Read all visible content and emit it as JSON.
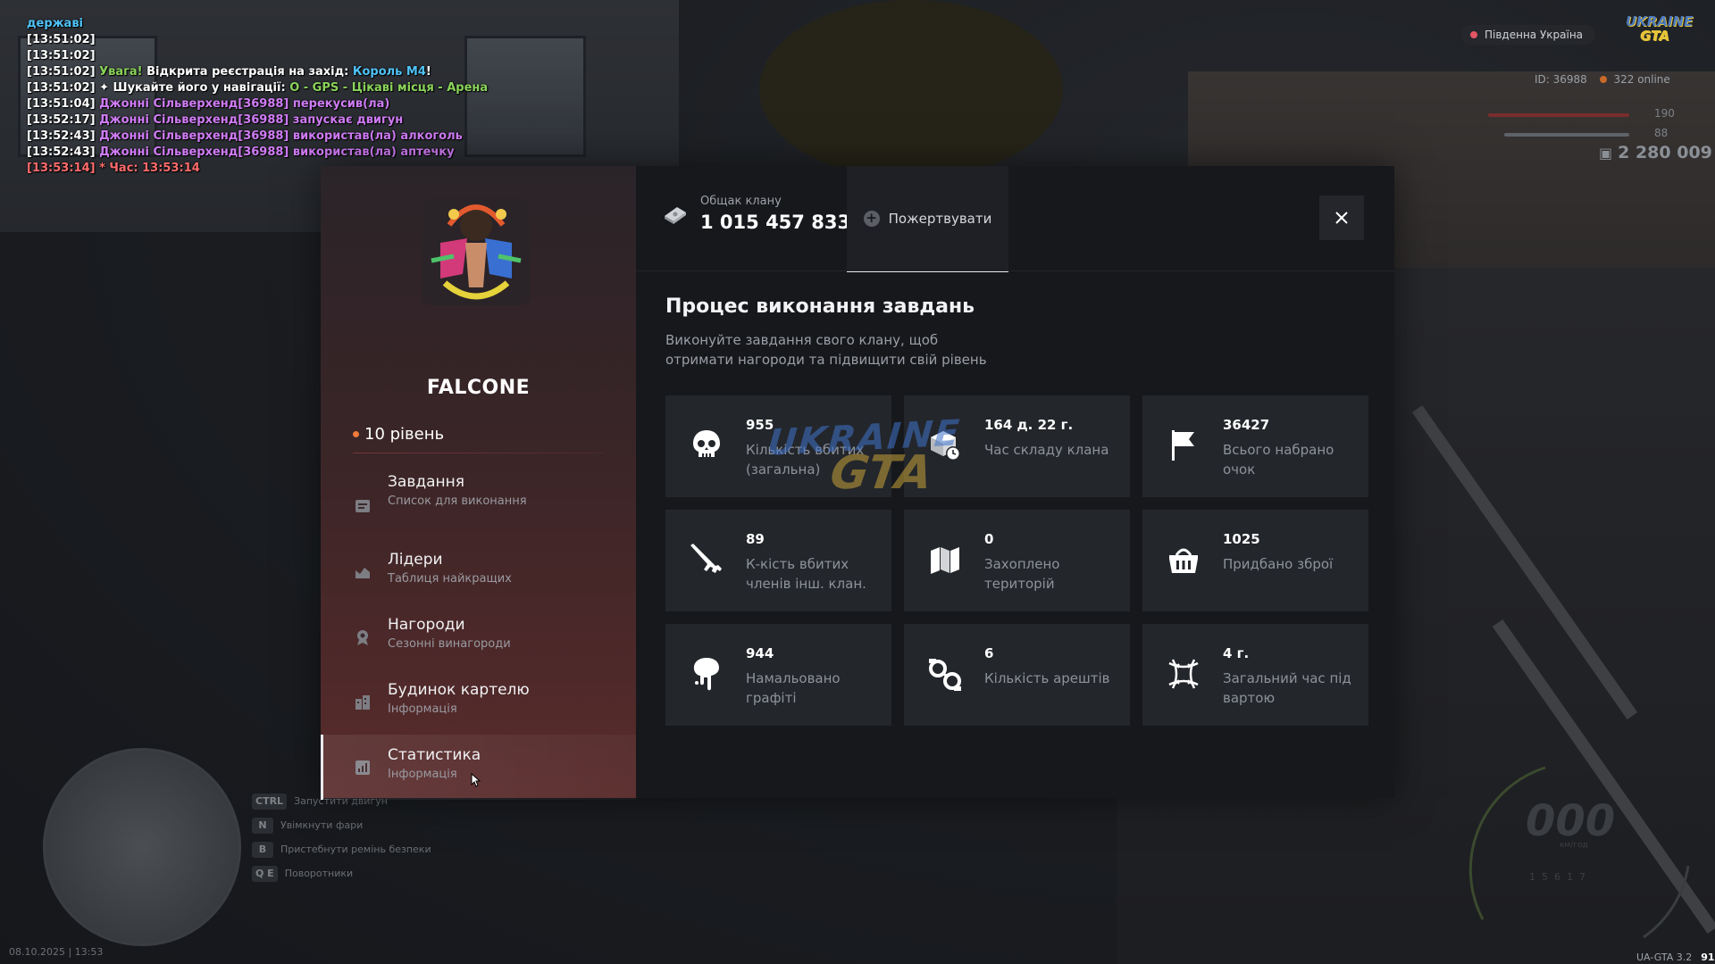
{
  "chat": [
    {
      "time": "",
      "parts": [
        {
          "t": "державі",
          "c": "cyan"
        }
      ]
    },
    {
      "time": "[13:51:02]",
      "parts": []
    },
    {
      "time": "[13:51:02]",
      "parts": []
    },
    {
      "time": "[13:51:02]",
      "parts": [
        {
          "t": " Увага! ",
          "c": "green"
        },
        {
          "t": "Відкрита реєстрація на захід: ",
          "c": "white"
        },
        {
          "t": "Король М4",
          "c": "cyan"
        },
        {
          "t": "!",
          "c": "white"
        }
      ]
    },
    {
      "time": "[13:51:02]",
      "parts": [
        {
          "t": " ✦ Шукайте його у навігації: ",
          "c": "white"
        },
        {
          "t": "O - GPS - Цікаві місця - Арена",
          "c": "green"
        }
      ]
    },
    {
      "time": "[13:51:04]",
      "parts": [
        {
          "t": " Джонні Сільверхенд[36988] перекусив(ла)",
          "c": "purple"
        }
      ]
    },
    {
      "time": "[13:52:17]",
      "parts": [
        {
          "t": " Джонні Сільверхенд[36988] запускає двигун",
          "c": "purple"
        }
      ]
    },
    {
      "time": "[13:52:43]",
      "parts": [
        {
          "t": " Джонні Сільверхенд[36988] використав(ла) алкоголь",
          "c": "purple"
        }
      ]
    },
    {
      "time": "[13:52:43]",
      "parts": [
        {
          "t": " Джонні Сільверхенд[36988] використав(ла) аптечку",
          "c": "purple"
        }
      ]
    },
    {
      "time": "[13:53:14]",
      "parts": [
        {
          "t": " * Час: 13:53:14",
          "c": "red"
        }
      ],
      "time_color": "red"
    }
  ],
  "hud": {
    "server": "Південна Україна",
    "logo": [
      "UKRAINE",
      "GTA"
    ],
    "id_text": "ID: 36988",
    "online_text": "322 online",
    "health": "190",
    "armor": "88",
    "money": "2 280 009",
    "speed": "000",
    "speed_unit": "км/год",
    "gears": "1  5  6  1  7"
  },
  "keys": [
    {
      "key": "CTRL",
      "label": "Запустити двигун"
    },
    {
      "key": "N",
      "label": "Увімкнути фари"
    },
    {
      "key": "B",
      "label": "Пристебнути ремінь безпеки"
    },
    {
      "key": "Q  E",
      "label": "Поворотники"
    }
  ],
  "datetime": "08.10.2025 | 13:53",
  "version": "UA-GTA 3.2",
  "fps": "91",
  "clan": {
    "name": "FALCONE",
    "level": "10 рівень"
  },
  "menu": [
    {
      "title": "Завдання",
      "sub": "Список для виконання",
      "icon": "tasks-icon"
    },
    {
      "title": "Лідери",
      "sub": "Таблиця найкращих",
      "icon": "leaders-icon"
    },
    {
      "title": "Нагороди",
      "sub": "Сезонні винагороди",
      "icon": "rewards-icon"
    },
    {
      "title": "Будинок картелю",
      "sub": "Інформація",
      "icon": "house-icon"
    },
    {
      "title": "Статистика",
      "sub": "Інформація",
      "icon": "stats-icon",
      "active": true
    }
  ],
  "treasury": {
    "label": "Общак клану",
    "value": "1 015 457 833"
  },
  "donate_label": "Пожертвувати",
  "section_title": "Процес виконання завдань",
  "section_desc": "Виконуйте завдання свого клану, щоб отримати нагороди та підвищити свій рівень",
  "stats": [
    {
      "value": "955",
      "label": "Кількість вбитих (загальна)",
      "icon": "skull-icon"
    },
    {
      "value": "164 д. 22 г.",
      "label": "Час складу клана",
      "icon": "cube-clock-icon"
    },
    {
      "value": "36427",
      "label": "Всього набрано очок",
      "icon": "flag-icon"
    },
    {
      "value": "89",
      "label": "К-кість вбитих членів інш. клан.",
      "icon": "rifle-icon"
    },
    {
      "value": "0",
      "label": "Захоплено територій",
      "icon": "map-icon"
    },
    {
      "value": "1025",
      "label": "Придбано зброї",
      "icon": "basket-icon"
    },
    {
      "value": "944",
      "label": "Намальовано графіті",
      "icon": "paint-drip-icon"
    },
    {
      "value": "6",
      "label": "Кількість арештів",
      "icon": "handcuffs-icon"
    },
    {
      "value": "4 г.",
      "label": "Загальний час під вартою",
      "icon": "barbed-wire-icon"
    }
  ],
  "watermark": [
    "UKRAINE",
    "GTA"
  ],
  "colors": {
    "accent_level": "#f07a3a",
    "sidebar_gradient_end": "#5a2b2b",
    "content_bg": "#16181c",
    "card_bg": "#23262b"
  }
}
